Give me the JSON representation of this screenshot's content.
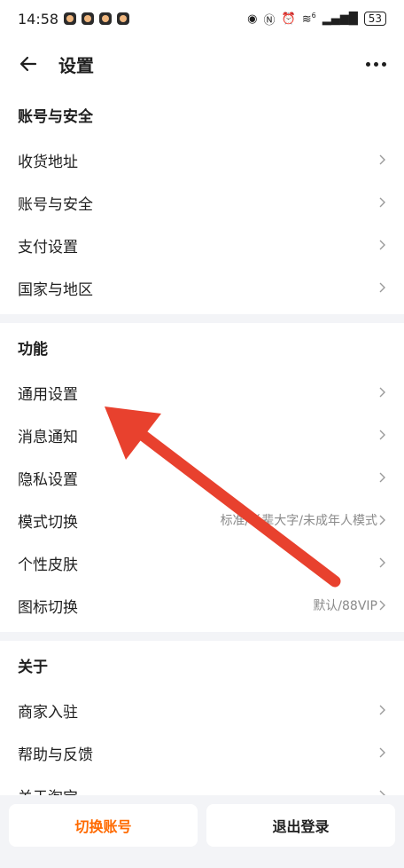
{
  "status_bar": {
    "time": "14:58",
    "battery": "53",
    "signal_label": "6"
  },
  "header": {
    "title": "设置",
    "back_icon": "back-arrow-icon",
    "more_icon": "more-dots-icon"
  },
  "sections": {
    "account": {
      "title": "账号与安全",
      "items": [
        "收货地址",
        "账号与安全",
        "支付设置",
        "国家与地区"
      ]
    },
    "features": {
      "title": "功能",
      "items": [
        {
          "label": "通用设置",
          "value": ""
        },
        {
          "label": "消息通知",
          "value": ""
        },
        {
          "label": "隐私设置",
          "value": ""
        },
        {
          "label": "模式切换",
          "value": "标准/长辈大字/未成年人模式"
        },
        {
          "label": "个性皮肤",
          "value": ""
        },
        {
          "label": "图标切换",
          "value": "默认/88VIP"
        }
      ]
    },
    "about": {
      "title": "关于",
      "items": [
        "商家入驻",
        "帮助与反馈",
        "关于淘宝"
      ]
    }
  },
  "bottom": {
    "switch_label": "切换账号",
    "logout_label": "退出登录"
  },
  "colors": {
    "accent": "#ff6a00",
    "annotation_arrow": "#e8412e",
    "background": "#f3f4f7"
  }
}
